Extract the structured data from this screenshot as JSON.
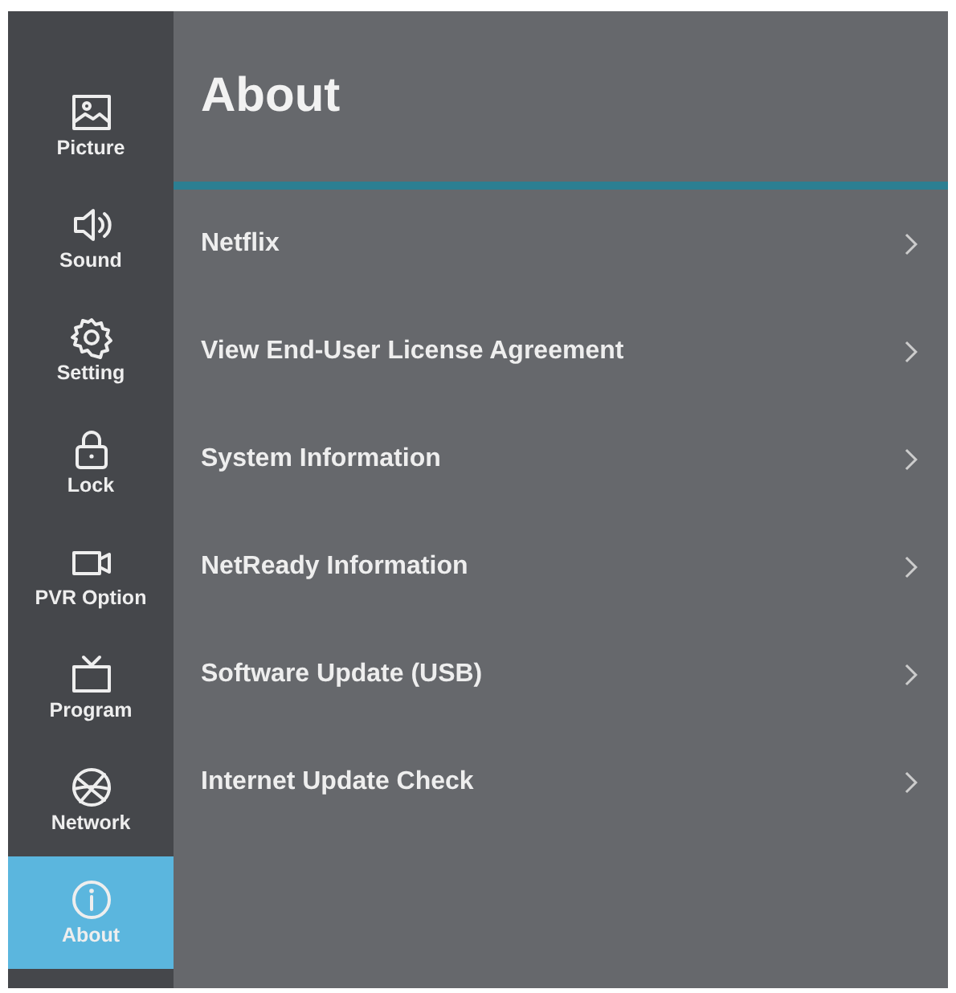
{
  "sidebar": {
    "items": [
      {
        "label": "Picture",
        "selected": false
      },
      {
        "label": "Sound",
        "selected": false
      },
      {
        "label": "Setting",
        "selected": false
      },
      {
        "label": "Lock",
        "selected": false
      },
      {
        "label": "PVR Option",
        "selected": false
      },
      {
        "label": "Program",
        "selected": false
      },
      {
        "label": "Network",
        "selected": false
      },
      {
        "label": "About",
        "selected": true
      }
    ]
  },
  "page": {
    "title": "About",
    "items": [
      {
        "label": "Netflix"
      },
      {
        "label": "View End-User License Agreement"
      },
      {
        "label": "System Information"
      },
      {
        "label": "NetReady Information"
      },
      {
        "label": "Software Update (USB)"
      },
      {
        "label": "Internet Update Check"
      }
    ]
  }
}
